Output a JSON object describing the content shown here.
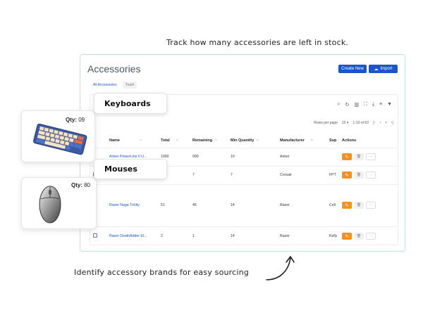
{
  "captions": {
    "top": "Track how many accessories are left in stock.",
    "bottom": "Identify accessory brands for easy sourcing"
  },
  "app": {
    "title": "Accessories",
    "buttons": {
      "create": "Create New",
      "import": "Import"
    },
    "tabs": [
      "All Accessories",
      "Trash"
    ],
    "pager": {
      "rows_label": "Rows per page",
      "rows_value": "10",
      "range": "1-10 of 63"
    },
    "columns": [
      "Name",
      "Total",
      "Remaining",
      "Min Quantity",
      "Manufacturer",
      "Sup",
      "Actions"
    ],
    "rows": [
      {
        "name": "Anker PowerLine II U...",
        "total": "1000",
        "remaining": "999",
        "min": "10",
        "manufacturer": "Anker",
        "sup": ""
      },
      {
        "name": "",
        "total": "",
        "remaining": "7",
        "min": "7",
        "manufacturer": "Corsair",
        "sup": "FPT"
      },
      {
        "name": "Razer Naga Trinity",
        "total": "51",
        "remaining": "46",
        "min": "14",
        "manufacturer": "Razer",
        "sup": "Cell"
      },
      {
        "name": "Razer DeathAdder El...",
        "total": "2",
        "remaining": "1",
        "min": "14",
        "manufacturer": "Razer",
        "sup": "Kelly"
      }
    ]
  },
  "overlays": {
    "keyboards": {
      "label": "Keyboards",
      "qty_label": "Qty:",
      "qty_value": "09"
    },
    "mouses": {
      "label": "Mouses",
      "qty_label": "Qty:",
      "qty_value": "80"
    }
  },
  "icons": {
    "toolbar": [
      "search-icon",
      "refresh-icon",
      "columns-icon",
      "fullscreen-icon",
      "download-icon",
      "sort-icon",
      "filter-icon"
    ],
    "pager": [
      "first-page-icon",
      "prev-page-icon",
      "next-page-icon",
      "last-page-icon"
    ]
  },
  "colors": {
    "primary": "#1a56c8",
    "edit": "#f39222",
    "card_border": "#bfe6d4"
  }
}
